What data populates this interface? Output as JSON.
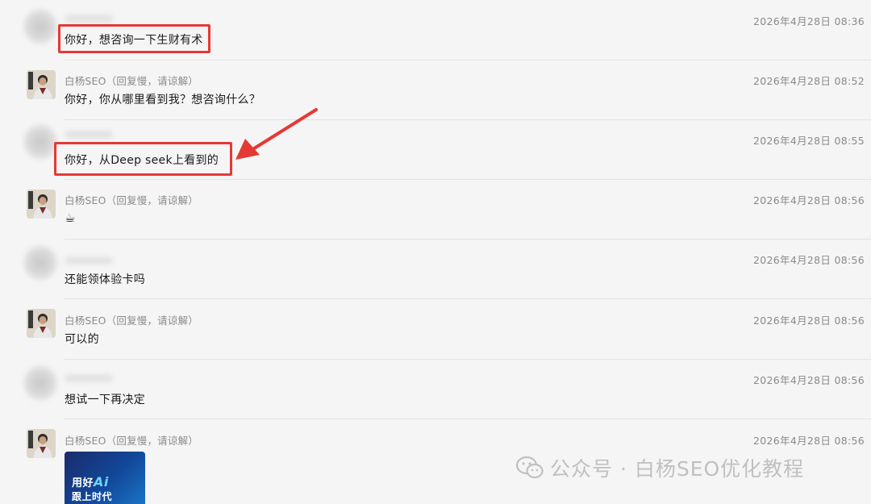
{
  "messages": [
    {
      "sender": "",
      "time": "2026年4月28日 08:36",
      "text": "你好，想咨询一下生财有术",
      "highlighted": true
    },
    {
      "sender": "白杨SEO（回复慢，请谅解）",
      "time": "2026年4月28日 08:52",
      "text": "你好，你从哪里看到我？想咨询什么？",
      "highlighted": false
    },
    {
      "sender": "",
      "time": "2026年4月28日 08:55",
      "text": "你好，从Deep seek上看到的",
      "highlighted": true
    },
    {
      "sender": "白杨SEO（回复慢，请谅解）",
      "time": "2026年4月28日 08:56",
      "text": "☕",
      "highlighted": false
    },
    {
      "sender": "",
      "time": "2026年4月28日 08:56",
      "text": "还能领体验卡吗",
      "highlighted": false
    },
    {
      "sender": "白杨SEO（回复慢，请谅解）",
      "time": "2026年4月28日 08:56",
      "text": "可以的",
      "highlighted": false
    },
    {
      "sender": "",
      "time": "2026年4月28日 08:56",
      "text": "想试一下再决定",
      "highlighted": false
    },
    {
      "sender": "白杨SEO（回复慢，请谅解）",
      "time": "2026年4月28日 08:56",
      "text": "",
      "highlighted": false
    }
  ],
  "card": {
    "header": "",
    "line1_prefix": "用好",
    "line1_accent": "Ai",
    "line2": "跟上时代"
  },
  "annotation": {
    "color": "#e53935"
  },
  "watermark": {
    "icon": "wechat-icon",
    "text": "公众号 · 白杨SEO优化教程"
  }
}
